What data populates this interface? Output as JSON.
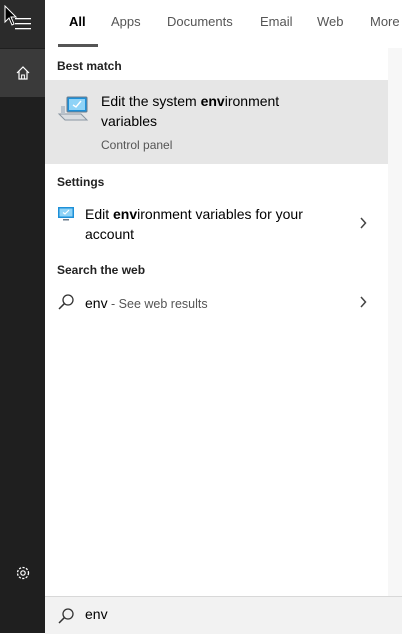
{
  "tabs": [
    "All",
    "Apps",
    "Documents",
    "Email",
    "Web",
    "More"
  ],
  "sections": {
    "best_match": "Best match",
    "settings": "Settings",
    "search_web": "Search the web"
  },
  "best_match": {
    "title_pre": "Edit the system ",
    "title_bold": "env",
    "title_post": "ironment",
    "title_line2": "variables",
    "subtitle": "Control panel",
    "icon": "system-properties-icon"
  },
  "settings_item": {
    "title_pre": "Edit ",
    "title_bold": "env",
    "title_post": "ironment variables for your",
    "title_line2": "account",
    "icon": "monitor-settings-icon"
  },
  "web_item": {
    "query": "env",
    "suffix": " - See web results",
    "icon": "search-icon"
  },
  "search": {
    "value": "env"
  },
  "rail": {
    "icons": [
      "hamburger-menu-icon",
      "home-icon",
      "gear-icon"
    ]
  },
  "colors": {
    "rail_bg": "#1f1f1f",
    "panel_bg": "#f2f2f2",
    "highlight": "#e6e6e6",
    "accent": "#0078d7"
  }
}
